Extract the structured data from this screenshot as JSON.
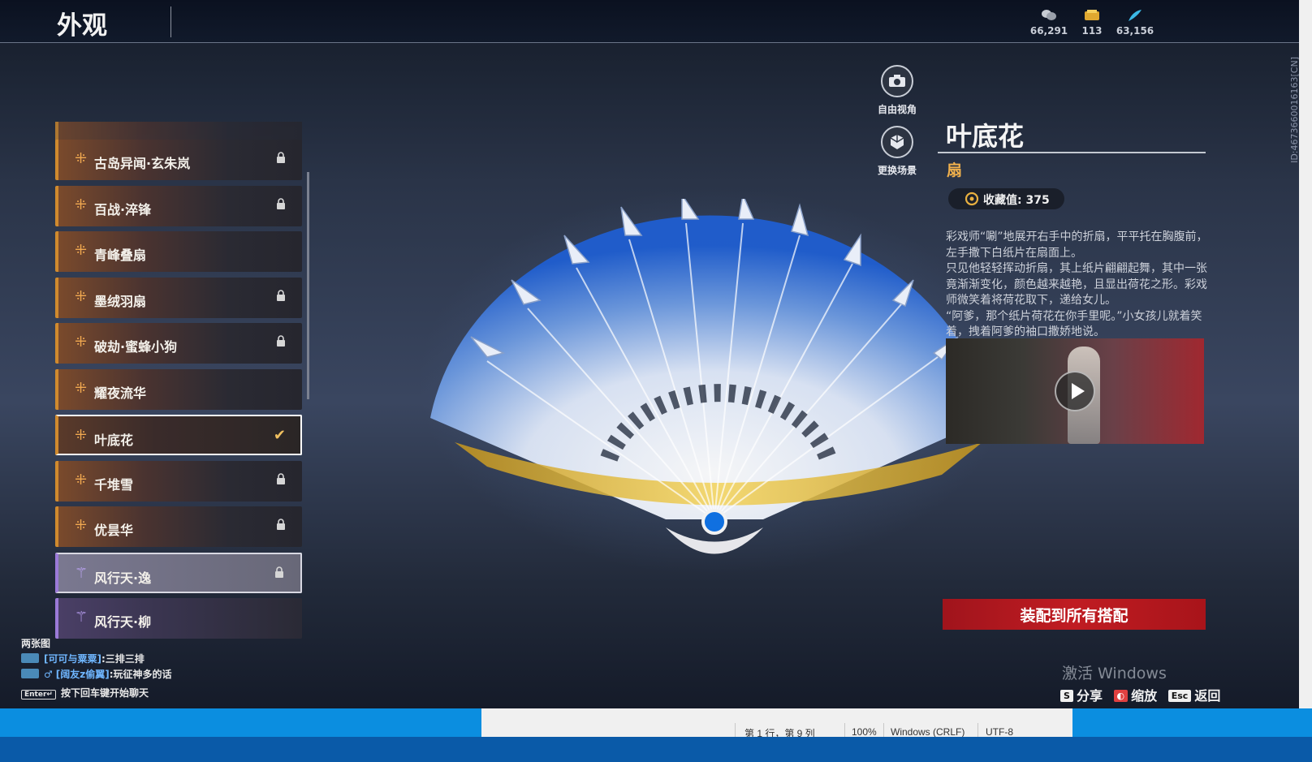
{
  "header": {
    "title": "外观",
    "currencies": [
      {
        "icon": "coin-stack-icon",
        "value": "66,291"
      },
      {
        "icon": "ticket-icon",
        "value": "113"
      },
      {
        "icon": "feather-icon",
        "value": "63,156"
      }
    ],
    "user_id": "ID:4673660016163[CN]"
  },
  "list": {
    "items": [
      {
        "label": "古岛异闻·玄朱岚",
        "locked": true
      },
      {
        "label": "百战·淬锋",
        "locked": true
      },
      {
        "label": "青峰叠扇",
        "locked": false
      },
      {
        "label": "墨绒羽扇",
        "locked": true
      },
      {
        "label": "破劫·蜜蜂小狗",
        "locked": true
      },
      {
        "label": "耀夜流华",
        "locked": false
      },
      {
        "label": "叶底花",
        "locked": false,
        "selected": true
      },
      {
        "label": "千堆雪",
        "locked": true
      },
      {
        "label": "优昙华",
        "locked": true
      },
      {
        "label": "风行天·逸",
        "locked": true
      },
      {
        "label": "风行天·柳",
        "locked": false
      }
    ]
  },
  "tools": {
    "free_view": "自由视角",
    "change_scene": "更换场景"
  },
  "detail": {
    "name": "叶底花",
    "type": "扇",
    "collection_label": "收藏值: 375",
    "description": [
      "彩戏师“唰”地展开右手中的折扇，平平托在胸腹前，左手撒下白纸片在扇面上。",
      "只见他轻轻挥动折扇，其上纸片翩翩起舞，其中一张竟渐渐变化，颜色越来越艳，且显出荷花之形。彩戏师微笑着将荷花取下，递给女儿。",
      "“阿爹，那个纸片荷花在你手里呢。”小女孩儿就着笑着，拽着阿爹的袖口撒娇地说。"
    ],
    "equip_button": "装配到所有搭配"
  },
  "chat": {
    "partial": "两张图",
    "lines": [
      {
        "name": "[可可与粟粟]",
        "text": ":三排三排"
      },
      {
        "name": "[阔友z偷翼]",
        "text": ":玩征神多的话"
      }
    ],
    "enter_key": "Enter↵",
    "hint": "按下回车键开始聊天"
  },
  "hotkeys": [
    {
      "key": "S",
      "label": "分享"
    },
    {
      "key": "",
      "label": "缩放"
    },
    {
      "key": "Esc",
      "label": "返回"
    }
  ],
  "watermark": "激活 Windows",
  "status_bar": {
    "position": "第 1 行，第 9 列",
    "zoom": "100%",
    "line_ending": "Windows (CRLF)",
    "encoding": "UTF-8"
  },
  "colors": {
    "accent_orange": "#d08a2e",
    "equip_red": "#c01c22",
    "purple_rarity": "#9b7ad8"
  }
}
